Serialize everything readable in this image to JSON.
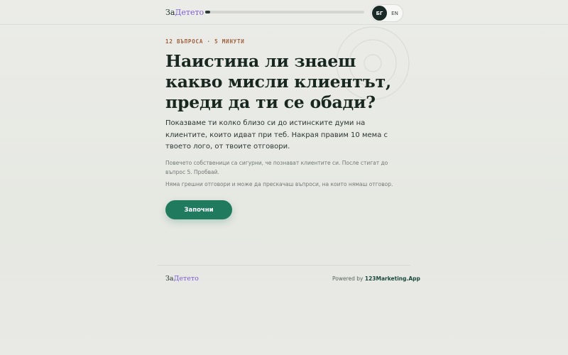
{
  "header": {
    "logo_part1": "За",
    "logo_part2": "Детето",
    "progress": 0.03,
    "lang_active": "БГ",
    "lang_other": "EN"
  },
  "intro": {
    "meta": "12 ВЪПРОСА · 5 МИНУТИ",
    "headline": "Наистина ли знаеш какво мисли клиентът, преди да ти се обади?",
    "lead": "Показваме ти колко близо си до истинските думи на клиентите, които идват при теб. Накрая правим 10 мема с твоето лого, от твоите отговори.",
    "note1": "Повечето собственици са сигурни, че познават клиентите си. После стигат до въпрос 5. Пробвай.",
    "note2": "Няма грешни отговори и може да прескачаш въпроси, на които нямаш отговор.",
    "start_label": "Започни"
  },
  "footer": {
    "logo_part1": "За",
    "logo_part2": "Детето",
    "powered_prefix": "Powered by",
    "powered_brand": "123Marketing.App"
  },
  "colors": {
    "accent": "#1f7a5e",
    "logo_accent": "#7b5bd6",
    "meta": "#a0603a"
  }
}
